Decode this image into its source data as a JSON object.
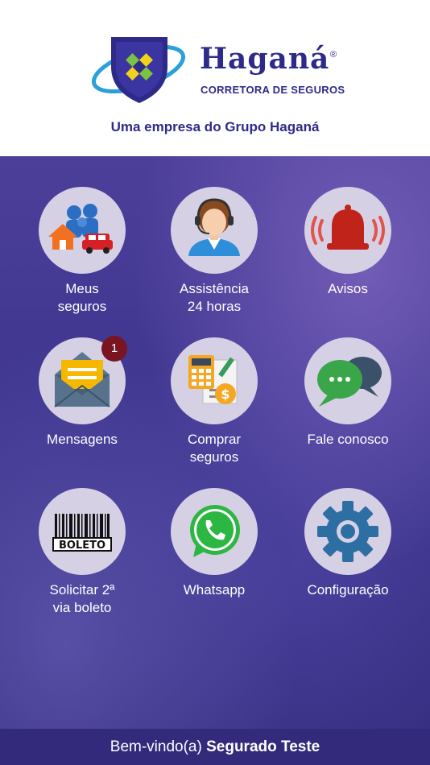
{
  "header": {
    "brand_name": "Haganá",
    "brand_reg": "®",
    "brand_subtitle": "CORRETORA DE SEGUROS",
    "tagline": "Uma empresa do Grupo Haganá"
  },
  "menu": [
    {
      "line1": "Meus",
      "line2": "seguros",
      "icon": "family-house-car-icon"
    },
    {
      "line1": "Assistência",
      "line2": "24 horas",
      "icon": "headset-agent-icon"
    },
    {
      "line1": "Avisos",
      "line2": "",
      "icon": "alarm-bell-icon"
    },
    {
      "line1": "Mensagens",
      "line2": "",
      "icon": "envelope-icon",
      "badge": "1"
    },
    {
      "line1": "Comprar",
      "line2": "seguros",
      "icon": "calculator-document-icon"
    },
    {
      "line1": "Fale conosco",
      "line2": "",
      "icon": "chat-bubbles-icon"
    },
    {
      "line1": "Solicitar 2ª",
      "line2": "via boleto",
      "icon": "barcode-boleto-icon",
      "icon_text": "BOLETO"
    },
    {
      "line1": "Whatsapp",
      "line2": "",
      "icon": "whatsapp-icon"
    },
    {
      "line1": "Configuração",
      "line2": "",
      "icon": "gear-icon"
    }
  ],
  "footer": {
    "greeting": "Bem-vindo(a)",
    "user_name": "Segurado Teste"
  },
  "colors": {
    "brand": "#2e2a88",
    "badge": "#7a1420",
    "footer": "#332a7c"
  }
}
